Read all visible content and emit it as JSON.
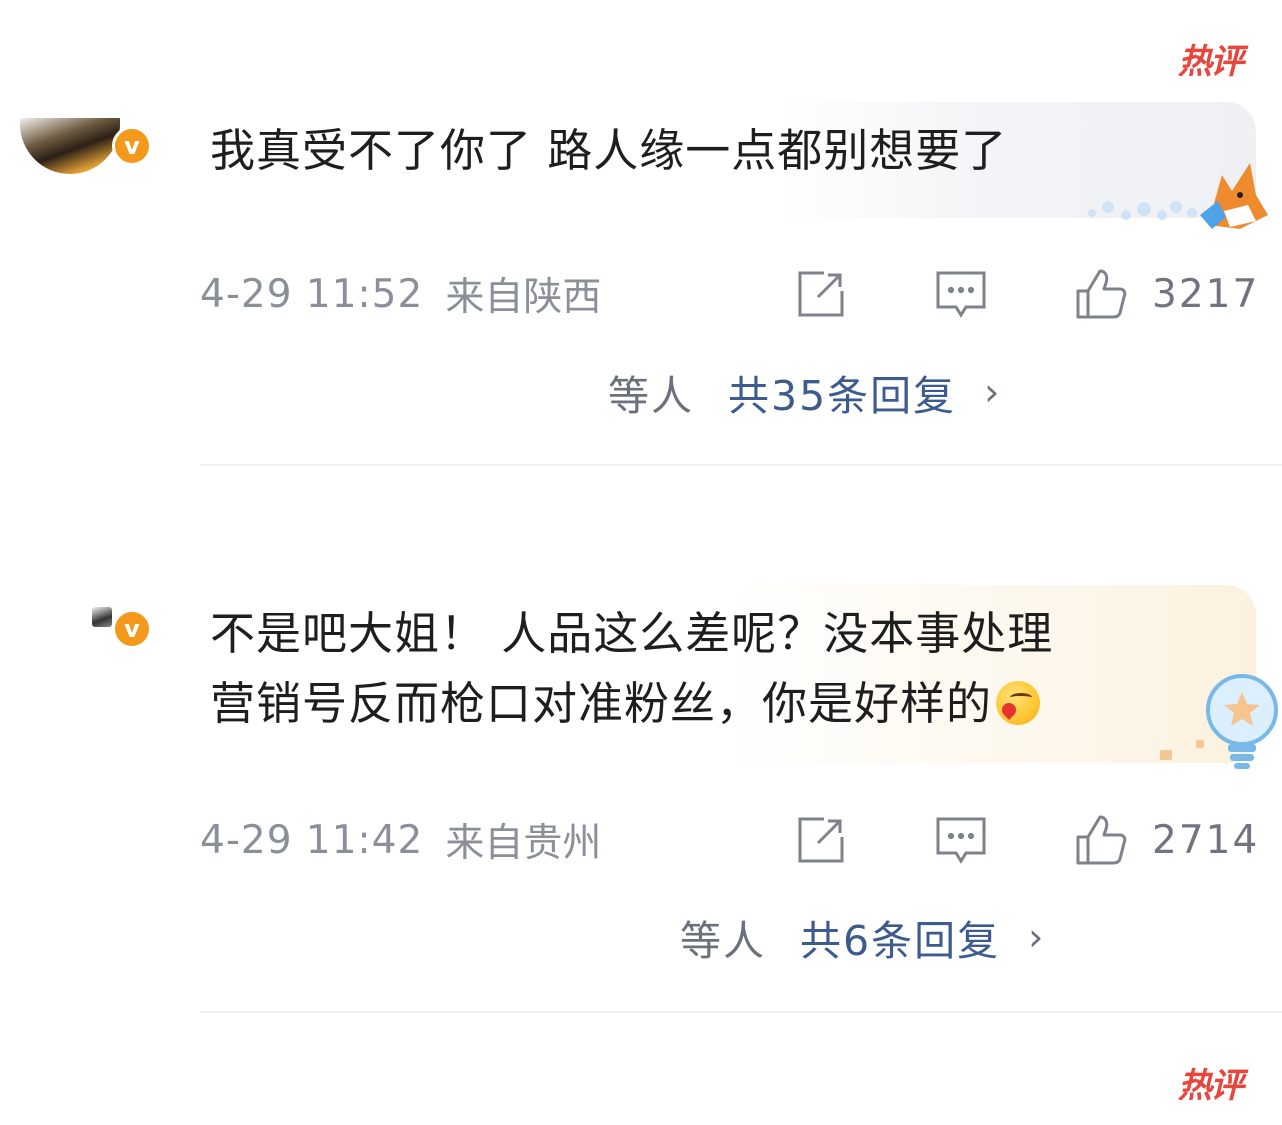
{
  "hot_label": "热评",
  "comments": [
    {
      "text": "我真受不了你了 路人缘一点都别想要了",
      "time": "4-29 11:52",
      "location": "来自陕西",
      "likes": "3217",
      "reply_users": "等人",
      "reply_count_label": "共35条回复",
      "verified_mark": "v"
    },
    {
      "text_line1": "不是吧大姐！ 人品这么差呢？没本事处理",
      "text_line2": "营销号反而枪口对准粉丝，你是好样的",
      "time": "4-29 11:42",
      "location": "来自贵州",
      "likes": "2714",
      "reply_users": "等人",
      "reply_count_label": "共6条回复",
      "verified_mark": "v"
    }
  ],
  "chevron": "›",
  "colors": {
    "hot": "#e8453c",
    "link": "#3d5b8f",
    "meta": "#8a8f99",
    "verified": "#f39a1c"
  }
}
